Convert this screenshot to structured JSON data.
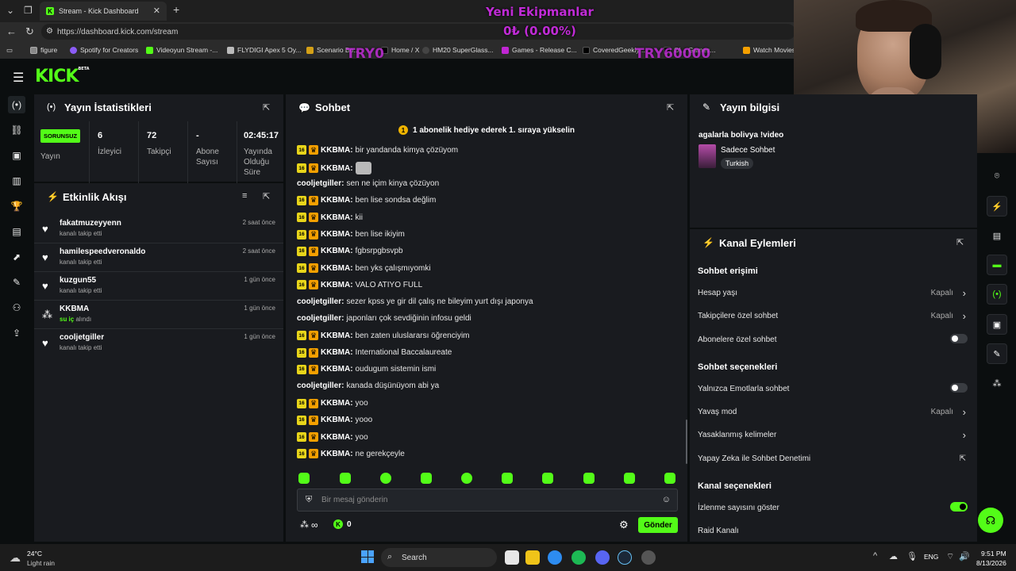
{
  "browser": {
    "tab_title": "Stream - Kick Dashboard",
    "tab_close": "✕",
    "new_tab": "+",
    "url": "https://dashboard.kick.com/stream",
    "bookmarks": [
      {
        "label": "figure",
        "color": "#888888"
      },
      {
        "label": "Spotify for Creators",
        "color": "#8b5cf6"
      },
      {
        "label": "Videoyun Stream -...",
        "color": "#53fc18"
      },
      {
        "label": "FLYDIGI Apex 5 Oy...",
        "color": "#bbbbbb"
      },
      {
        "label": "Scenario Bo...",
        "color": "#d4a017"
      },
      {
        "label": "Home / X",
        "color": "#000000"
      },
      {
        "label": "HM20 SuperGlass...",
        "color": "#444444"
      },
      {
        "label": "Games - Release C...",
        "color": "#c026d3"
      },
      {
        "label": "CoveredGeekly ...",
        "color": "#000000"
      },
      {
        "label": "Ol... Games...",
        "color": "#000000"
      },
      {
        "label": "Watch Movies",
        "color": "#f5a000"
      }
    ]
  },
  "overlay": {
    "title": "Yeni Ekipmanlar",
    "amount": "0₺ (0.00%)",
    "left_value": "TRY0",
    "right_value": "TRY60000"
  },
  "header": {
    "logo": "KICK",
    "logo_badge": "BETA"
  },
  "stats": {
    "title": "Yayın İstatistikleri",
    "status": "SORUNSUZ",
    "status_label": "Yayın",
    "viewers": "6",
    "viewers_label": "İzleyici",
    "followers": "72",
    "followers_label": "Takipçi",
    "subs": "-",
    "subs_label": "Abone Sayısı",
    "uptime": "02:45:17",
    "uptime_label": "Yayında Olduğu Süre"
  },
  "activity": {
    "title": "Etkinlik Akışı",
    "items": [
      {
        "name": "fakatmuzeyyenn",
        "sub": "kanalı takip etti",
        "time": "2 saat önce",
        "icon": "♥"
      },
      {
        "name": "hamilespeedveronaldo",
        "sub": "kanalı takip etti",
        "time": "2 saat önce",
        "icon": "♥"
      },
      {
        "name": "kuzgun55",
        "sub": "kanalı takip etti",
        "time": "1 gün önce",
        "icon": "♥"
      },
      {
        "name": "KKBMA",
        "sub_green": "su iç",
        "sub": "alındı",
        "time": "1 gün önce",
        "icon": "⁂"
      },
      {
        "name": "cooljetgiller",
        "sub": "kanalı takip etti",
        "time": "1 gün önce",
        "icon": "♥"
      }
    ]
  },
  "chat": {
    "title": "Sohbet",
    "banner": "1 abonelik hediye ederek 1. sıraya yükselin",
    "banner_coin": "1",
    "sub_badge": "16",
    "messages": [
      {
        "user": "KKBMA:",
        "text": "bir yandanda kimya çözüyom",
        "badges": true
      },
      {
        "user": "KKBMA:",
        "text": "",
        "badges": true,
        "emote": true
      },
      {
        "user": "cooljetgiller:",
        "text": "sen ne içim kinya çözüyon",
        "badges": false
      },
      {
        "user": "KKBMA:",
        "text": "ben lise sondsa değlim",
        "badges": true
      },
      {
        "user": "KKBMA:",
        "text": "kii",
        "badges": true
      },
      {
        "user": "KKBMA:",
        "text": "ben lise ikiyim",
        "badges": true
      },
      {
        "user": "KKBMA:",
        "text": "fgbsrpgbsvpb",
        "badges": true
      },
      {
        "user": "KKBMA:",
        "text": "ben yks çalışmıyomki",
        "badges": true
      },
      {
        "user": "KKBMA:",
        "text": "VALO ATIYO FULL",
        "badges": true
      },
      {
        "user": "cooljetgiller:",
        "text": "sezer kpss ye gir dil çalış ne bileyim yurt dışı japonya",
        "badges": false
      },
      {
        "user": "cooljetgiller:",
        "text": "japonları çok sevdiğinin infosu geldi",
        "badges": false
      },
      {
        "user": "KKBMA:",
        "text": "ben zaten uluslararsı öğrenciyim",
        "badges": true
      },
      {
        "user": "KKBMA:",
        "text": "International Baccalaureate",
        "badges": true
      },
      {
        "user": "KKBMA:",
        "text": "oudugum sistemin ismi",
        "badges": true
      },
      {
        "user": "cooljetgiller:",
        "text": "kanada düşünüyom abi ya",
        "badges": false
      },
      {
        "user": "KKBMA:",
        "text": "yoo",
        "badges": true
      },
      {
        "user": "KKBMA:",
        "text": "yooo",
        "badges": true
      },
      {
        "user": "KKBMA:",
        "text": "yoo",
        "badges": true
      },
      {
        "user": "KKBMA:",
        "text": "ne gerekçeyle",
        "badges": true
      }
    ],
    "input_placeholder": "Bir mesaj gönderin",
    "points": "∞",
    "kicks": "0",
    "send": "Gönder"
  },
  "stream_info": {
    "title": "Yayın bilgisi",
    "stream_title": "agalarla bolivya !video",
    "category": "Sadece Sohbet",
    "language": "Turkish"
  },
  "channel_actions": {
    "title": "Kanal Eylemleri",
    "chat_access_header": "Sohbet erişimi",
    "account_age": "Hesap yaşı",
    "account_age_val": "Kapalı",
    "followers_only": "Takipçilere özel sohbet",
    "followers_only_val": "Kapalı",
    "subs_only": "Abonelere özel sohbet",
    "chat_options_header": "Sohbet seçenekleri",
    "emote_only": "Yalnızca Emotlarla sohbet",
    "slow_mode": "Yavaş mod",
    "slow_mode_val": "Kapalı",
    "banned_words": "Yasaklanmış kelimeler",
    "ai_moderation": "Yapay Zeka ile Sohbet Denetimi",
    "channel_options_header": "Kanal seçenekleri",
    "show_viewers": "İzlenme sayısını göster",
    "raid": "Raid Kanalı"
  },
  "taskbar": {
    "temp": "24°C",
    "weather": "Light rain",
    "search": "Search",
    "lang": "ENG",
    "time": "9:51 PM",
    "date": "8/13/2026"
  }
}
